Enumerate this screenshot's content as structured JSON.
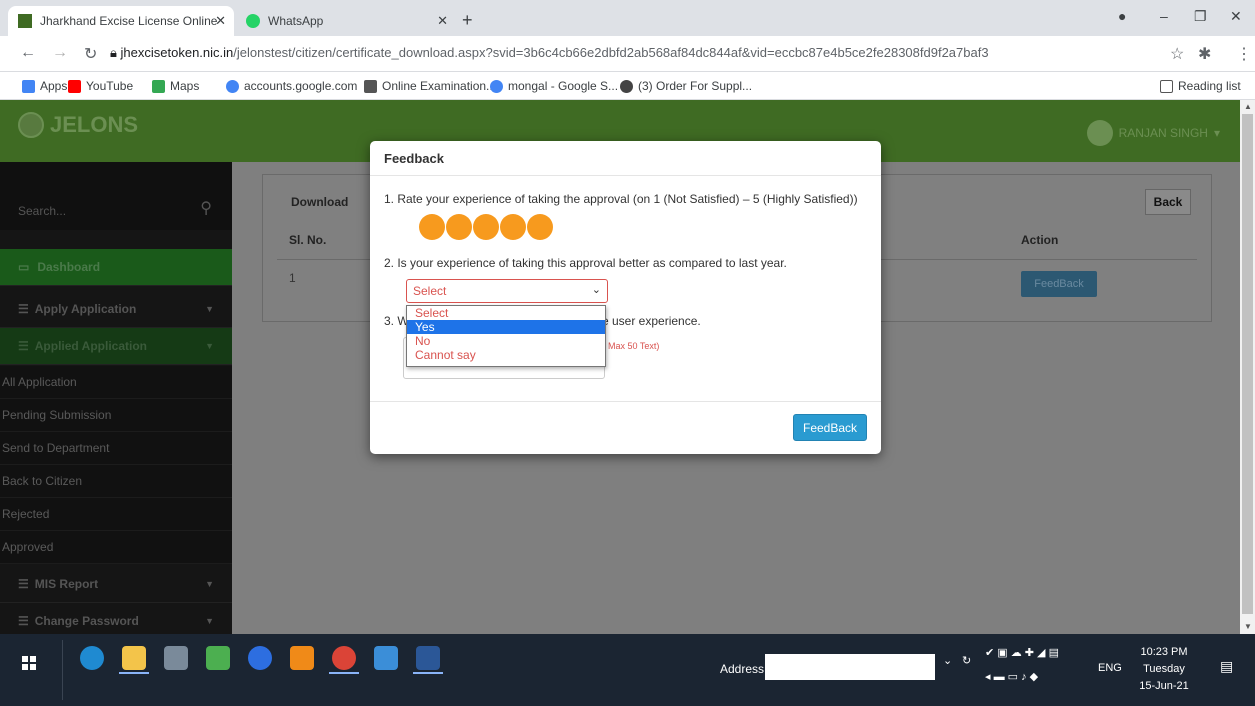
{
  "browser": {
    "tabs": [
      {
        "title": "Jharkhand Excise License Online"
      },
      {
        "title": "WhatsApp"
      }
    ],
    "url_host": "jhexcisetoken.nic.in",
    "url_path": "/jelonstest/citizen/certificate_download.aspx?svid=3b6c4cb66e2dbfd2ab568af84dc844af&vid=eccbc87e4b5ce2fe28308fd9f2a7baf3",
    "bookmarks": [
      "Apps",
      "YouTube",
      "Maps",
      "accounts.google.com",
      "Online Examination...",
      "mongal - Google S...",
      "(3) Order For Suppl..."
    ],
    "reading_list": "Reading list"
  },
  "app": {
    "logo": "JELONS",
    "user": "RANJAN SINGH"
  },
  "sidebar": {
    "search_placeholder": "Search...",
    "menu": [
      "Dashboard",
      "Apply Application",
      "Applied Application"
    ],
    "sub": [
      "All Application",
      "Pending Submission",
      "Send to Department",
      "Back to Citizen",
      "Rejected",
      "Approved"
    ],
    "menu2": [
      "MIS Report",
      "Change Password"
    ]
  },
  "panel": {
    "title": "Download",
    "back": "Back",
    "col_sl": "Sl. No.",
    "col_action": "Action",
    "row_sl": "1",
    "row_action": "FeedBack"
  },
  "modal": {
    "title": "Feedback",
    "q1": "1. Rate your experience of taking the approval (on 1 (Not Satisfied) – 5 (Highly Satisfied))",
    "stars": 5,
    "q2": "2. Is your experience of taking this approval better as compared to last year.",
    "select_value": "Select",
    "q3_start": "3. W",
    "q3_end": "e user experience.",
    "hint": "Max 50 Text)",
    "submit": "FeedBack",
    "options": [
      "Select",
      "Yes",
      "No",
      "Cannot say"
    ],
    "highlighted_option": "Yes"
  },
  "taskbar": {
    "address_label": "Address",
    "lang": "ENG",
    "time": "10:23 PM",
    "day": "Tuesday",
    "date": "15-Jun-21"
  },
  "colors": {
    "header": "#3f6b23",
    "star": "#f79a1e",
    "button": "#2a9bd1",
    "error": "#d9534f"
  }
}
